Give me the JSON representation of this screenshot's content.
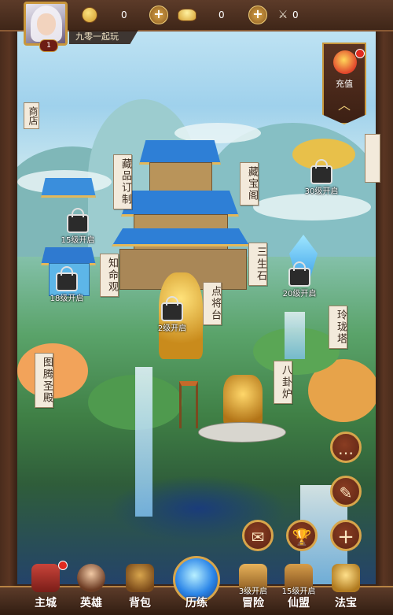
{
  "top_bar": {
    "player_name": "九零一起玩",
    "player_level": "1",
    "copper": "0",
    "gold": "0",
    "power": "0"
  },
  "recharge": {
    "label": "充值"
  },
  "shop_tab": "商店",
  "buildings": [
    {
      "name": "藏品订制"
    },
    {
      "name": "藏宝阁"
    },
    {
      "name": "知命观"
    },
    {
      "name": "点将台"
    },
    {
      "name": "三生石"
    },
    {
      "name": "玲珑塔"
    },
    {
      "name": "图腾圣殿"
    },
    {
      "name": "八卦炉"
    }
  ],
  "locks": {
    "lock_top_right": "30级开启",
    "lock_left_upper": "15级开启",
    "lock_left_lower": "18级开启",
    "lock_center": "2级开启",
    "lock_right": "20级开启"
  },
  "side_buttons": {
    "chat": "…",
    "note": "✎",
    "mail": "✉",
    "trophy": "🏆",
    "add": "+"
  },
  "nav": [
    {
      "label": "主城",
      "caption": ""
    },
    {
      "label": "英雄",
      "caption": ""
    },
    {
      "label": "背包",
      "caption": ""
    },
    {
      "label": "历练",
      "caption": ""
    },
    {
      "label": "冒险",
      "caption": "3级开启"
    },
    {
      "label": "仙盟",
      "caption": "15级开启"
    },
    {
      "label": "法宝",
      "caption": ""
    }
  ]
}
